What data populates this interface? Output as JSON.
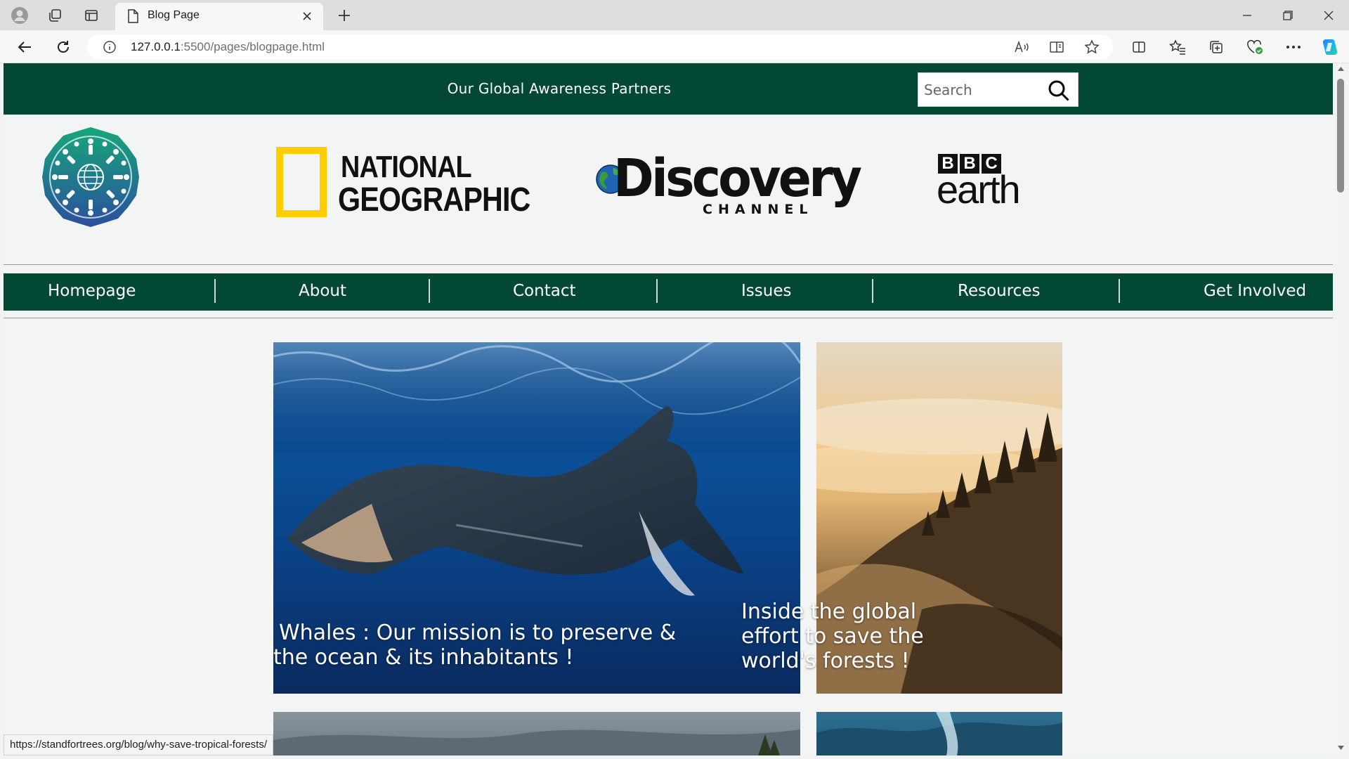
{
  "browser": {
    "tab_title": "Blog Page",
    "url_host": "127.0.0.1",
    "url_rest": ":5500/pages/blogpage.html",
    "status_url": "https://standfortrees.org/blog/why-save-tropical-forests/"
  },
  "header": {
    "partners_text": "Our Global Awareness Partners",
    "search_placeholder": "Search"
  },
  "logos": {
    "natgeo_line1": "NATIONAL",
    "natgeo_line2": "GEOGRAPHIC",
    "discovery_main": "Discovery",
    "discovery_sub": "CHANNEL",
    "bbc_letters": [
      "B",
      "B",
      "C"
    ],
    "bbc_earth": "earth"
  },
  "nav": {
    "items": [
      "Homepage",
      "About",
      "Contact",
      "Issues",
      "Resources",
      "Get Involved"
    ]
  },
  "cards": [
    {
      "line1": "Whales : Our mission is to preserve &",
      "line2": "the ocean & its inhabitants !"
    },
    {
      "line1": "Inside the global",
      "line2": "effort to save the",
      "line3": "world's forests !"
    }
  ],
  "colors": {
    "brand_green": "#034834",
    "natgeo_yellow": "#ffce00"
  }
}
